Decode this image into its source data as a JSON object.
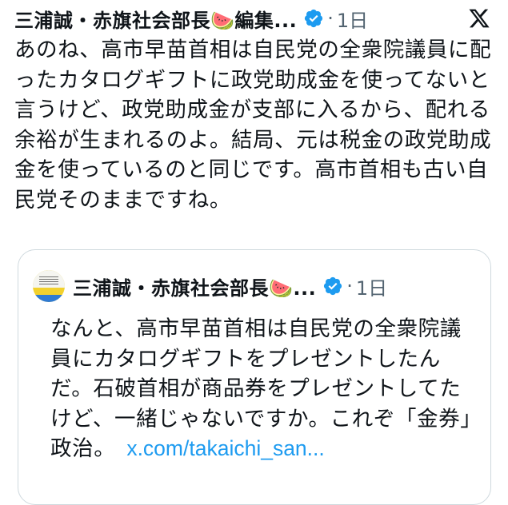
{
  "tweet": {
    "author": "三浦誠・赤旗社会部長🍉編集...",
    "dot": "·",
    "time": "1日",
    "text": "あのね、高市早苗首相は自民党の全衆院議員に配ったカタログギフトに政党助成金を使ってないと言うけど、政党助成金が支部に入るから、配れる余裕が生まれるのよ。結局、元は税金の政党助成金を使っているのと同じです。高市首相も古い自民党そのままですね。"
  },
  "quote": {
    "author": "三浦誠・赤旗社会部長🍉...",
    "dot": "·",
    "time": "1日",
    "text": "なんと、高市早苗首相は自民党の全衆院議員にカタログギフトをプレゼントしたんだ。石破首相が商品券をプレゼントしてたけど、一緒じゃないですか。これぞ「金券」政治。",
    "link": "x.com/takaichi_san..."
  },
  "icons": {
    "verified": "verified-badge-icon",
    "x_logo": "x-logo-icon",
    "avatar": "avatar"
  },
  "colors": {
    "verified": "#1d9bf0",
    "link": "#1d9bf0",
    "muted": "#536471",
    "border": "#cfd9de"
  }
}
